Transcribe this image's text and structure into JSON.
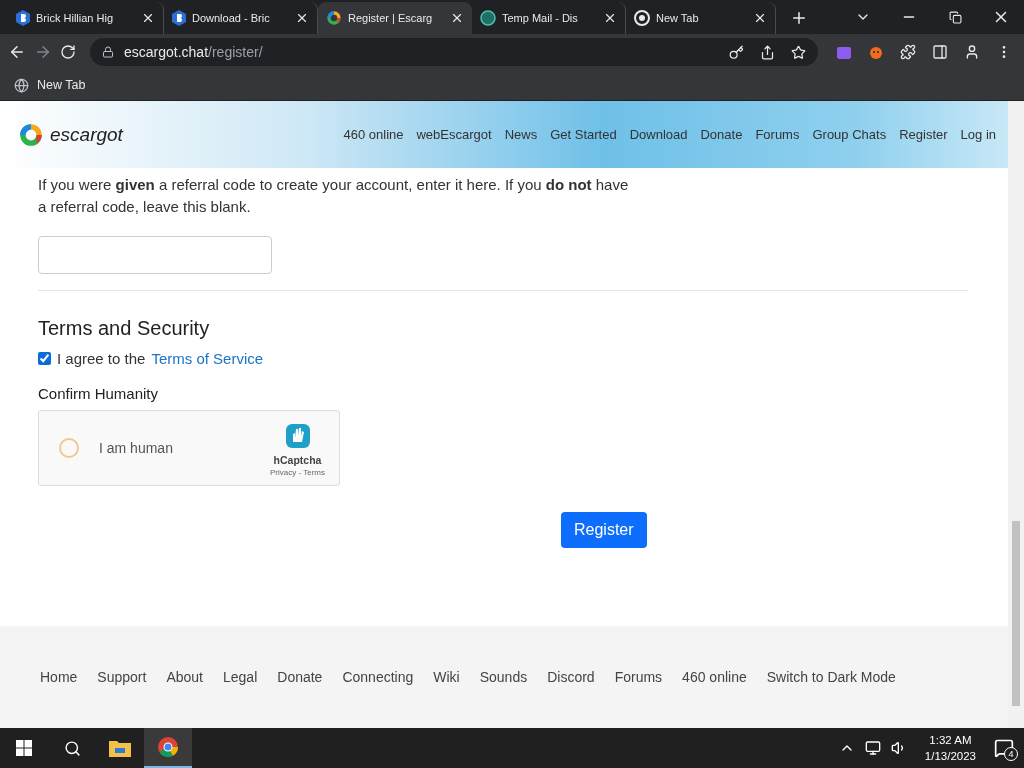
{
  "browser": {
    "tabs": [
      {
        "title": "Brick Hillian Hig",
        "kind": "brick",
        "selected": false
      },
      {
        "title": "Download - Bric",
        "kind": "brick",
        "selected": false
      },
      {
        "title": "Register | Escarg",
        "kind": "escargot",
        "selected": true
      },
      {
        "title": "Temp Mail - Dis",
        "kind": "tempmail",
        "selected": false
      },
      {
        "title": "New Tab",
        "kind": "chrome",
        "selected": false
      }
    ],
    "url": {
      "domain": "escargot.chat",
      "path": "/register/"
    },
    "bookmarks": [
      {
        "label": "New Tab"
      }
    ]
  },
  "site": {
    "logo": "escargot",
    "nav": [
      "460 online",
      "webEscargot",
      "News",
      "Get Started",
      "Download",
      "Donate",
      "Forums",
      "Group Chats",
      "Register",
      "Log in"
    ],
    "referral": {
      "text": "If you were **given** a referral code to create your account, enter it here. If you **do not** have a referral code, leave this blank."
    },
    "terms": {
      "heading": "Terms and Security",
      "agree_text": "I agree to the",
      "link": "Terms of Service",
      "checked": true
    },
    "humanity": {
      "heading": "Confirm Humanity",
      "label": "I am human",
      "checked": false,
      "brand": "hCaptcha",
      "links": "Privacy - Terms"
    },
    "submit": "Register",
    "footer": [
      "Home",
      "Support",
      "About",
      "Legal",
      "Donate",
      "Connecting",
      "Wiki",
      "Sounds",
      "Discord",
      "Forums",
      "460 online",
      "Switch to Dark Mode"
    ]
  },
  "taskbar": {
    "time": "1:32 AM",
    "date": "1/13/2023",
    "notifications": "4"
  }
}
